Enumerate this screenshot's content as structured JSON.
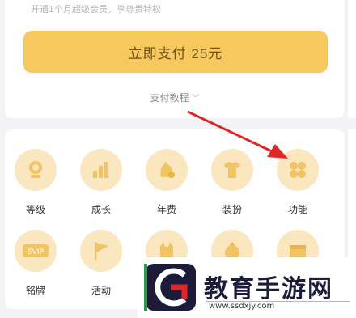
{
  "header": {
    "subtitle": "开通1个月超级会员，享尊贵特权"
  },
  "payment": {
    "button_label": "立即支付 25元",
    "tutorial_label": "支付教程",
    "chevron": "chevron-down-icon"
  },
  "features": {
    "row1": [
      {
        "label": "等级",
        "icon": "medal-icon"
      },
      {
        "label": "成长",
        "icon": "growth-bars-icon"
      },
      {
        "label": "年费",
        "icon": "annual-fee-icon"
      },
      {
        "label": "装扮",
        "icon": "tshirt-icon"
      },
      {
        "label": "功能",
        "icon": "clover-function-icon"
      }
    ],
    "row2": [
      {
        "label": "铭牌",
        "icon": "svip-nameplate-icon"
      },
      {
        "label": "活动",
        "icon": "flag-icon"
      },
      {
        "label": "",
        "icon": "cat-icon"
      },
      {
        "label": "",
        "icon": "gift-icon"
      },
      {
        "label": "",
        "icon": "box-icon"
      }
    ]
  },
  "watermark": {
    "title": "教育手游网",
    "url": "www.ssdxjy.com"
  },
  "colors": {
    "accent": "#f7c85e",
    "icon_bg": "#fbe7bf",
    "icon_fg": "#f0c465",
    "arrow": "#e02626"
  }
}
